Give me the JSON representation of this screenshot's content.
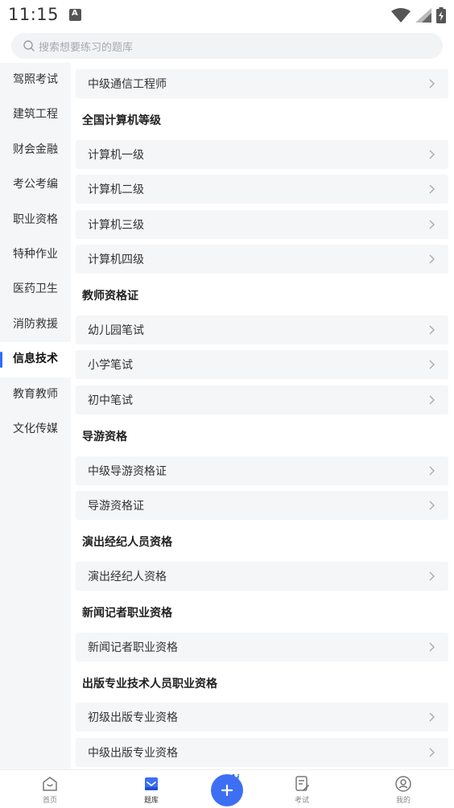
{
  "status": {
    "time": "11:15",
    "a_badge": "A"
  },
  "search": {
    "placeholder": "搜索想要练习的题库"
  },
  "sidebar": {
    "items": [
      {
        "label": "驾照考试"
      },
      {
        "label": "建筑工程"
      },
      {
        "label": "财会金融"
      },
      {
        "label": "考公考编"
      },
      {
        "label": "职业资格"
      },
      {
        "label": "特种作业"
      },
      {
        "label": "医药卫生"
      },
      {
        "label": "消防救援"
      },
      {
        "label": "信息技术",
        "active": true
      },
      {
        "label": "教育教师"
      },
      {
        "label": "文化传媒"
      }
    ]
  },
  "content": {
    "top_row": "中级通信工程师",
    "sections": [
      {
        "title": "全国计算机等级",
        "rows": [
          "计算机一级",
          "计算机二级",
          "计算机三级",
          "计算机四级"
        ]
      },
      {
        "title": "教师资格证",
        "rows": [
          "幼儿园笔试",
          "小学笔试",
          "初中笔试"
        ]
      },
      {
        "title": "导游资格",
        "rows": [
          "中级导游资格证",
          "导游资格证"
        ]
      },
      {
        "title": "演出经纪人员资格",
        "rows": [
          "演出经纪人资格"
        ]
      },
      {
        "title": "新闻记者职业资格",
        "rows": [
          "新闻记者职业资格"
        ]
      },
      {
        "title": "出版专业技术人员职业资格",
        "rows": [
          "初级出版专业资格",
          "中级出版专业资格"
        ]
      }
    ]
  },
  "tabbar": {
    "home": "首页",
    "bank": "题库",
    "fab_badge": "Ai",
    "exam": "考试",
    "mine": "我的"
  },
  "colors": {
    "accent": "#3d6ff5",
    "row_bg": "#f5f6f8",
    "sidebar_bg": "#f5f6f8"
  }
}
